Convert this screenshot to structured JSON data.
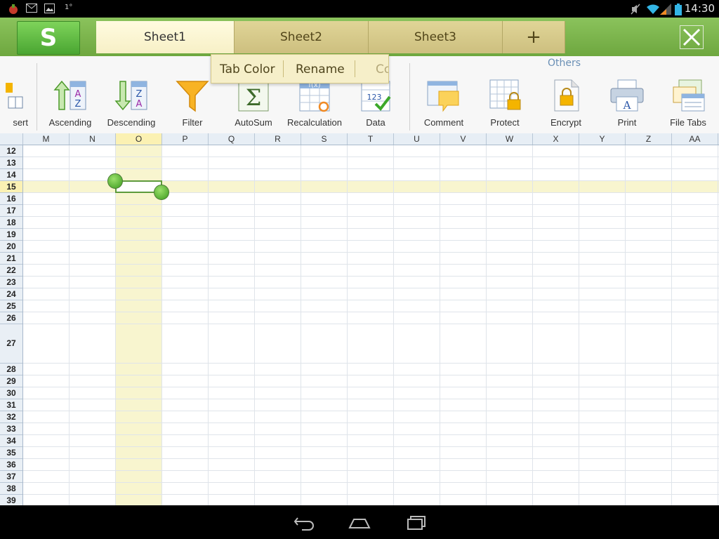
{
  "status_bar": {
    "time": "14:30",
    "notif_text": "1°"
  },
  "tabs": {
    "logo": "S",
    "sheets": [
      {
        "label": "Sheet1",
        "active": true
      },
      {
        "label": "Sheet2",
        "active": false
      },
      {
        "label": "Sheet3",
        "active": false
      }
    ],
    "add_label": "+"
  },
  "ribbon": {
    "partial_label": "sert",
    "others_label": "Others",
    "buttons": [
      {
        "label": "Ascending",
        "icon": "sort-ascending-icon"
      },
      {
        "label": "Descending",
        "icon": "sort-descending-icon"
      },
      {
        "label": "Filter",
        "icon": "filter-icon"
      },
      {
        "label": "AutoSum",
        "icon": "autosum-icon"
      },
      {
        "label": "Recalculation",
        "icon": "recalculation-icon"
      },
      {
        "label": "Data",
        "icon": "data-icon"
      },
      {
        "label": "Comment",
        "icon": "comment-icon"
      },
      {
        "label": "Protect",
        "icon": "protect-icon"
      },
      {
        "label": "Encrypt",
        "icon": "encrypt-icon"
      },
      {
        "label": "Print",
        "icon": "print-icon"
      },
      {
        "label": "File Tabs",
        "icon": "file-tabs-icon"
      }
    ]
  },
  "tab_popup": {
    "items": [
      "Tab Color",
      "Rename",
      "Co"
    ]
  },
  "grid": {
    "columns": [
      "M",
      "N",
      "O",
      "P",
      "Q",
      "R",
      "S",
      "T",
      "U",
      "V",
      "W",
      "X",
      "Y",
      "Z",
      "AA"
    ],
    "rows": [
      "12",
      "13",
      "14",
      "15",
      "16",
      "17",
      "18",
      "19",
      "20",
      "21",
      "22",
      "23",
      "24",
      "25",
      "26",
      "27",
      "28",
      "29",
      "30",
      "31",
      "32",
      "33",
      "34",
      "35",
      "36",
      "37",
      "38",
      "39"
    ],
    "selected_column": "O",
    "selected_row": "15"
  },
  "colors": {
    "accent_green": "#6ea73f",
    "tab_gold": "#cdbf7f",
    "selection_yellow": "#f8f5cf"
  }
}
